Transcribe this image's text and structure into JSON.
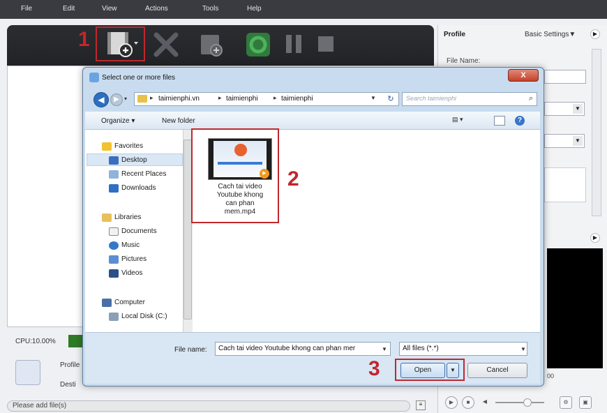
{
  "menu": [
    "File",
    "Edit",
    "View",
    "Actions",
    "Tools",
    "Help"
  ],
  "annotations": [
    "1",
    "2",
    "3"
  ],
  "right_panel": {
    "profile_label": "Profile",
    "basic_settings": "Basic Settings▼",
    "file_name_label": "File Name:",
    "time_partial": "00"
  },
  "status": {
    "cpu": "CPU:10.00%",
    "profile_short": "Profile",
    "destination_short": "Desti",
    "message": "Please add file(s)"
  },
  "dialog": {
    "title": "Select one or more files",
    "close": "X",
    "breadcrumbs": [
      "taimienphi.vn",
      "taimienphi",
      "taimienphi"
    ],
    "search_placeholder": "Search taimienphi",
    "organize": "Organize ▾",
    "new_folder": "New folder",
    "nav": {
      "favorites": "Favorites",
      "desktop": "Desktop",
      "recent_places": "Recent Places",
      "downloads": "Downloads",
      "libraries": "Libraries",
      "documents": "Documents",
      "music": "Music",
      "pictures": "Pictures",
      "videos": "Videos",
      "computer": "Computer",
      "local_disk": "Local Disk (C:)"
    },
    "file": {
      "name_line1": "Cach tai video",
      "name_line2": "Youtube khong",
      "name_line3": "can phan",
      "name_line4": "mem.mp4"
    },
    "file_name_label": "File name:",
    "file_name_value": "Cach tai video Youtube khong can phan mer",
    "filter": "All files (*.*)",
    "open": "Open",
    "cancel": "Cancel"
  },
  "colors": {
    "annotation_red": "#c1272d",
    "menubar": "#3a3b40",
    "toolbar": "#2c2d31",
    "dialog_frame": "#c9dcef"
  }
}
